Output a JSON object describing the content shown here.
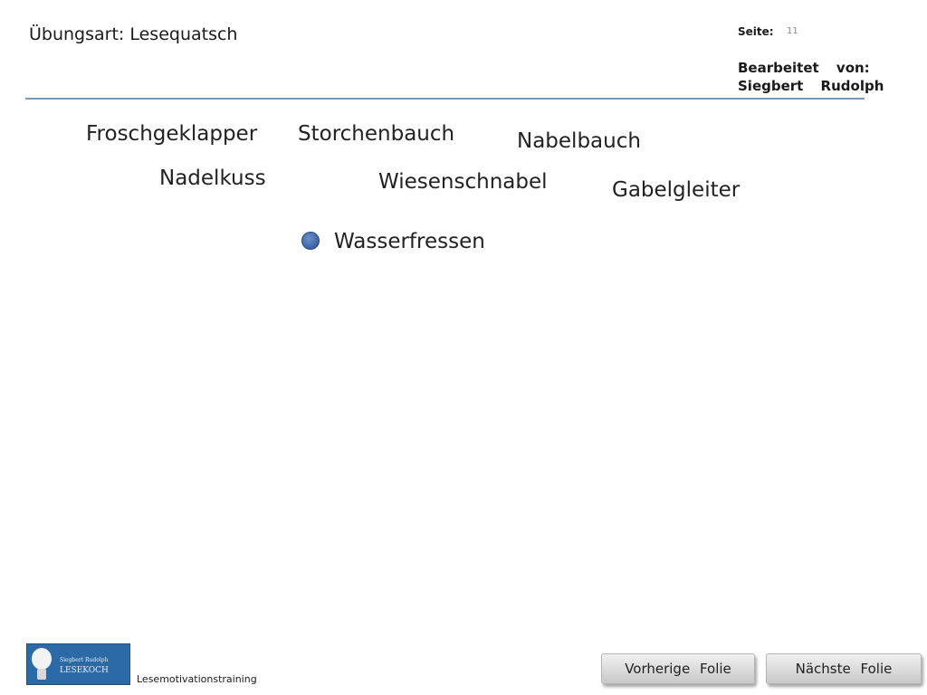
{
  "header": {
    "title": "Übungsart:  Lesequatsch",
    "page_label": "Seite:",
    "page_number": "11",
    "edited_by_label": "Bearbeitet von:",
    "author": "Siegbert Rudolph"
  },
  "words": [
    "Froschgeklapper",
    "Storchenbauch",
    "Nabelbauch",
    "Nadelkuss",
    "Wiesenschnabel",
    "Gabelgleiter"
  ],
  "highlighted_word": "Wasserfressen",
  "footer": {
    "logo_name": "Siegbert Rudolph",
    "logo_brand": "LESEKOCH",
    "label": "Lesemotivationstraining",
    "prev_button": "Vorherige Folie",
    "next_button": "Nächste Folie"
  },
  "colors": {
    "divider": "#7a98b8",
    "bullet": "#3a63a8",
    "logo_background": "#2b6aa6"
  }
}
